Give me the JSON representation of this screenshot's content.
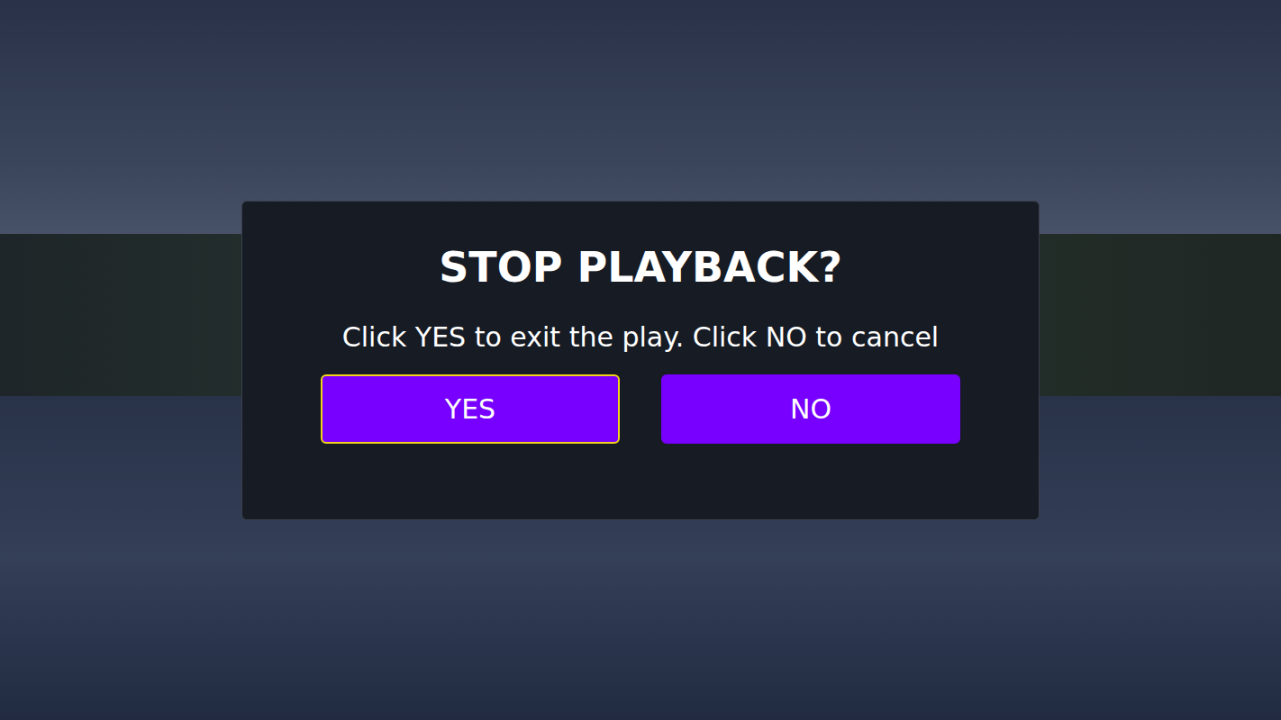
{
  "dialog": {
    "title": "STOP PLAYBACK?",
    "message": "Click YES to exit the play. Click NO to cancel",
    "buttons": [
      {
        "label": "YES",
        "selected": true
      },
      {
        "label": "NO",
        "selected": false
      }
    ]
  }
}
